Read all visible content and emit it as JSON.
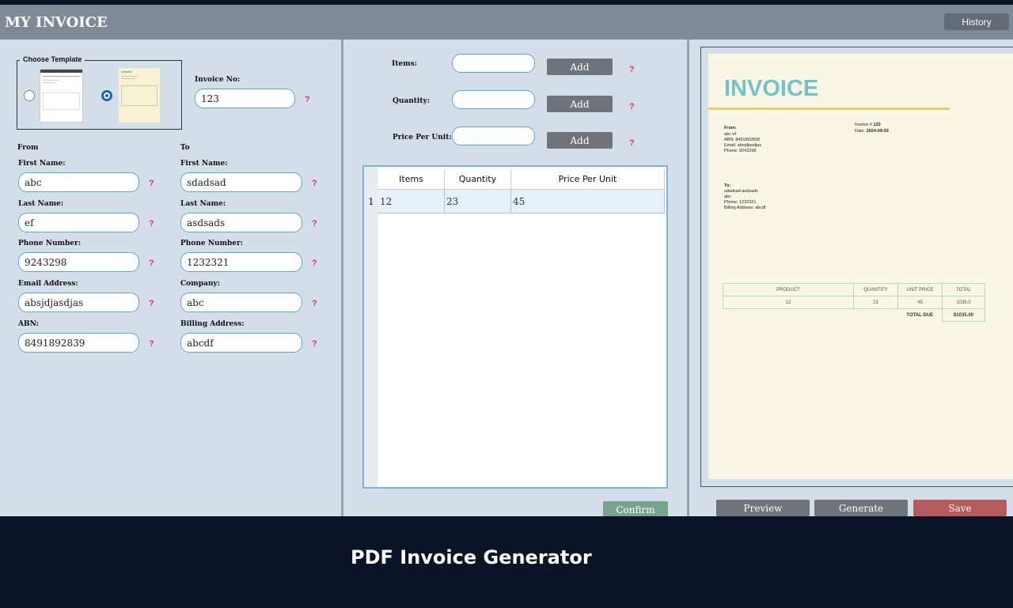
{
  "app": {
    "title": "MY INVOICE",
    "history_label": "History"
  },
  "template": {
    "legend": "Choose Template",
    "selected_index": 1
  },
  "invoice_no": {
    "label": "Invoice No:",
    "value": "123"
  },
  "help_mark": "?",
  "from": {
    "heading": "From",
    "fields": [
      {
        "label": "First Name:",
        "value": "abc"
      },
      {
        "label": "Last Name:",
        "value": "ef"
      },
      {
        "label": "Phone Number:",
        "value": "9243298"
      },
      {
        "label": "Email Address:",
        "value": "absjdjasdjas"
      },
      {
        "label": "ABN:",
        "value": "8491892839"
      }
    ]
  },
  "to": {
    "heading": "To",
    "fields": [
      {
        "label": "First Name:",
        "value": "sdadsad"
      },
      {
        "label": "Last Name:",
        "value": "asdsads"
      },
      {
        "label": "Phone Number:",
        "value": "1232321"
      },
      {
        "label": "Company:",
        "value": "abc"
      },
      {
        "label": "Billing Address:",
        "value": "abcdf"
      }
    ]
  },
  "entry": {
    "rows": [
      {
        "label": "Items:",
        "value": "",
        "button": "Add"
      },
      {
        "label": "Quantity:",
        "value": "",
        "button": "Add"
      },
      {
        "label": "Price Per Unit:",
        "value": "",
        "button": "Add"
      }
    ]
  },
  "table": {
    "columns": [
      "Items",
      "Quantity",
      "Price Per Unit"
    ],
    "rows": [
      {
        "num": "1",
        "cells": [
          "12",
          "23",
          "45"
        ]
      }
    ]
  },
  "confirm_label": "Confirm",
  "preview": {
    "heading": "INVOICE",
    "invoice_line_prefix": "Invoice # ",
    "invoice_number": "123",
    "date_prefix": "Date: ",
    "date": "2024-09-03",
    "from_label": "From:",
    "from_lines": [
      "abc ef",
      "ABN: 8491892839",
      "Email: absjdjasdjas",
      "Phone: 9243298"
    ],
    "to_label": "To:",
    "to_lines": [
      "sdadsad asdsads",
      "abc",
      "Phone: 1232321",
      "Billing Address: abcdf"
    ],
    "table_headers": [
      "PRODUCT",
      "QUANTITY",
      "UNIT PRICE",
      "TOTAL"
    ],
    "table_row": [
      "12",
      "23",
      "45",
      "1035.0"
    ],
    "total_due_label": "TOTAL DUE",
    "total_due_value": "$1035.00",
    "heading_color": "#6fc3c9",
    "rule_color": "#e6cf6b"
  },
  "actions": {
    "preview": "Preview",
    "generate": "Generate",
    "save": "Save",
    "save_color": "#b55a5d"
  },
  "footer": {
    "title": "PDF Invoice Generator"
  }
}
